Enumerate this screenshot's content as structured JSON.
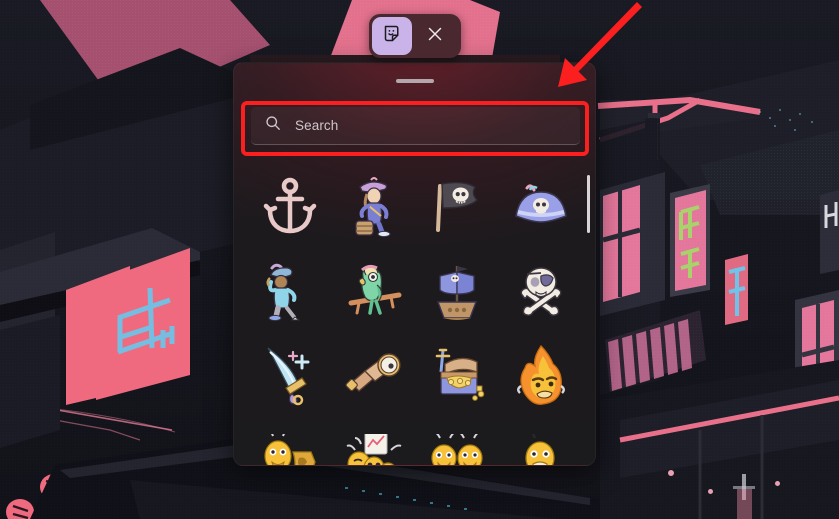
{
  "wallpaper": {
    "name": "cyberpunk-anime-street-wallpaper",
    "description": "Dark isometric neon city street at night with pink and green signage",
    "base_color": "#15161e",
    "neon_pink": "#ef6a7e",
    "neon_green": "#a8d36a",
    "neon_blue": "#6fc3e8"
  },
  "toolbar": {
    "name": "sticker-panel-toolbar",
    "background": "#4a2830",
    "buttons": [
      {
        "name": "sticker-tab",
        "icon": "sticker-icon",
        "selected": true,
        "selected_bg": "#c9b3e8"
      },
      {
        "name": "close-button",
        "icon": "close-icon",
        "selected": false
      }
    ]
  },
  "panel": {
    "name": "emoji-sticker-panel",
    "grabber_label": "",
    "search": {
      "placeholder": "Search",
      "value": "",
      "icon": "search-icon"
    },
    "scrollbar": {
      "visible": true,
      "color": "#d9d4d6"
    },
    "stickers": [
      {
        "id": "anchor",
        "label": "anchor",
        "row": 1,
        "col": 1
      },
      {
        "id": "pirate-woman",
        "label": "pirate woman with barrel",
        "row": 1,
        "col": 2
      },
      {
        "id": "pirate-flag",
        "label": "jolly roger flag",
        "row": 1,
        "col": 3
      },
      {
        "id": "pirate-hat",
        "label": "pirate captain hat",
        "row": 1,
        "col": 4
      },
      {
        "id": "pirate-man",
        "label": "pirate man with peg leg",
        "row": 2,
        "col": 1
      },
      {
        "id": "parrot",
        "label": "parrot on perch",
        "row": 2,
        "col": 2
      },
      {
        "id": "pirate-ship",
        "label": "pirate ship",
        "row": 2,
        "col": 3
      },
      {
        "id": "skull-crossbones",
        "label": "skull and crossbones",
        "row": 3,
        "col": 4
      },
      {
        "id": "cutlass",
        "label": "sparkling cutlass sword",
        "row": 3,
        "col": 1
      },
      {
        "id": "spyglass",
        "label": "spyglass telescope",
        "row": 3,
        "col": 2
      },
      {
        "id": "treasure-chest",
        "label": "treasure chest with gold",
        "row": 3,
        "col": 3
      },
      {
        "id": "angry-fire",
        "label": "angry fire emoji",
        "row": 3,
        "col": 4
      },
      {
        "id": "emoji-puzzle",
        "label": "emoji with puzzle piece",
        "row": 4,
        "col": 1
      },
      {
        "id": "emoji-party",
        "label": "emojis celebrating with chart",
        "row": 4,
        "col": 2
      },
      {
        "id": "emoji-pair",
        "label": "two emojis with trophy",
        "row": 4,
        "col": 3
      },
      {
        "id": "emoji-shout",
        "label": "shouting emoji",
        "row": 4,
        "col": 4
      }
    ]
  },
  "annotations": {
    "highlight_rect": {
      "name": "search-highlight-rectangle",
      "color": "#fb1f1f",
      "target": "search-input"
    },
    "arrow": {
      "name": "pointer-arrow",
      "color": "#fb1f1f",
      "direction": "down-left",
      "target": "search-input"
    }
  }
}
